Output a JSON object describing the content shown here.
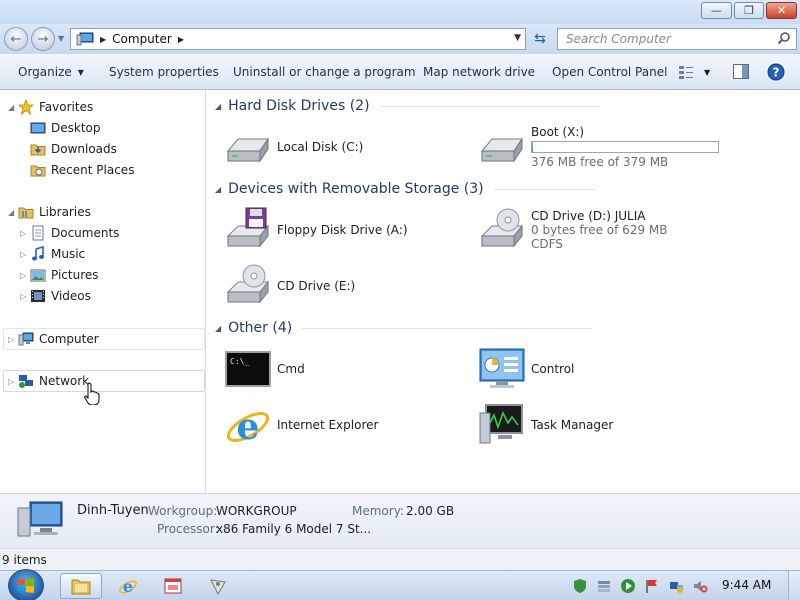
{
  "window": {
    "minimize_glyph": "—",
    "maximize_glyph": "❐",
    "close_glyph": "✕"
  },
  "address": {
    "location": "Computer",
    "search_placeholder": "Search Computer"
  },
  "toolbar": {
    "organize": "Organize",
    "system_properties": "System properties",
    "uninstall": "Uninstall or change a program",
    "map_drive": "Map network drive",
    "control_panel": "Open Control Panel"
  },
  "navpane": {
    "favorites": "Favorites",
    "desktop": "Desktop",
    "downloads": "Downloads",
    "recent": "Recent Places",
    "libraries": "Libraries",
    "documents": "Documents",
    "music": "Music",
    "pictures": "Pictures",
    "videos": "Videos",
    "computer": "Computer",
    "network": "Network"
  },
  "content": {
    "groups": {
      "hdd": "Hard Disk Drives (2)",
      "removable": "Devices with Removable Storage (3)",
      "other": "Other (4)"
    },
    "items": {
      "local_disk": {
        "name": "Local Disk (C:)"
      },
      "boot": {
        "name": "Boot (X:)",
        "free": "376 MB free of 379 MB",
        "used_fraction": 0.008
      },
      "floppy": {
        "name": "Floppy Disk Drive (A:)"
      },
      "cd_d": {
        "name": "CD Drive (D:) JULIA",
        "free": "0 bytes free of 629 MB",
        "fs": "CDFS"
      },
      "cd_e": {
        "name": "CD Drive (E:)"
      },
      "cmd": {
        "name": "Cmd",
        "screen_text": "C:\\_"
      },
      "control": {
        "name": "Control"
      },
      "ie": {
        "name": "Internet Explorer"
      },
      "taskmgr": {
        "name": "Task Manager"
      }
    }
  },
  "details": {
    "computer_name": "Dinh-Tuyen",
    "workgroup_label": "Workgroup:",
    "workgroup": "WORKGROUP",
    "memory_label": "Memory:",
    "memory": "2.00 GB",
    "processor_label": "Processor:",
    "processor": "x86 Family 6 Model 7 St..."
  },
  "status": {
    "items": "9 items"
  },
  "taskbar": {
    "clock": "9:44 AM"
  },
  "colors": {
    "accent": "#1e3a6e",
    "capacity_fill": "#1f8fd0"
  }
}
